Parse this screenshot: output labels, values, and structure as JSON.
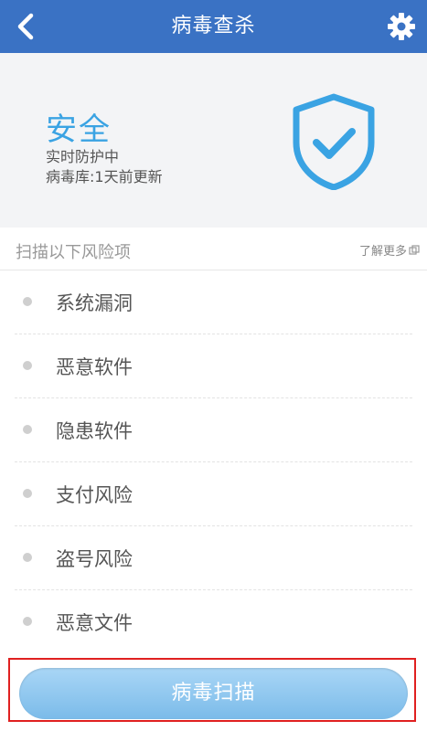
{
  "header": {
    "title": "病毒查杀",
    "back_icon": "chevron-left-icon",
    "settings_icon": "gear-icon",
    "bar_color": "#3a72c4"
  },
  "status": {
    "title": "安全",
    "line1": "实时防护中",
    "line2": "病毒库:1天前更新",
    "accent_color": "#3aa3e3",
    "icon": "shield-check-icon"
  },
  "section": {
    "title": "扫描以下风险项",
    "learn_more": "了解更多",
    "learn_more_icon": "external-link-icon"
  },
  "risks": [
    {
      "label": "系统漏洞"
    },
    {
      "label": "恶意软件"
    },
    {
      "label": "隐患软件"
    },
    {
      "label": "支付风险"
    },
    {
      "label": "盗号风险"
    },
    {
      "label": "恶意文件"
    }
  ],
  "actions": {
    "scan_label": "病毒扫描"
  }
}
